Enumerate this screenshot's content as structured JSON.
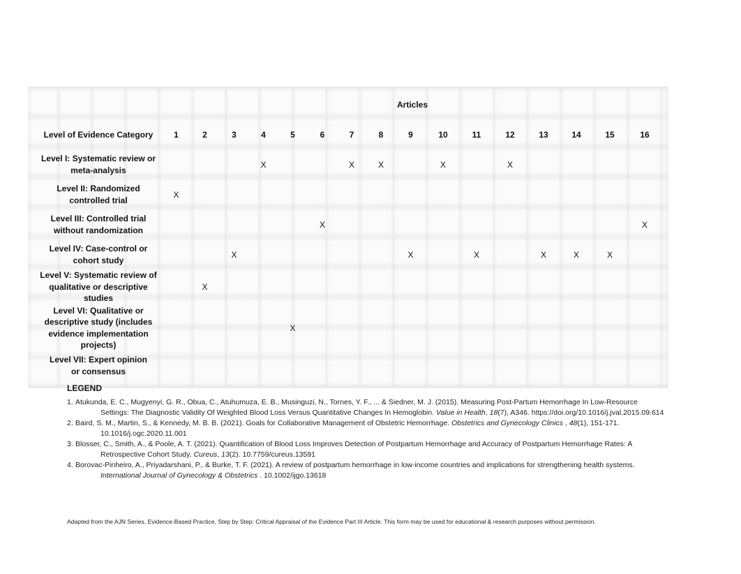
{
  "table": {
    "articles_header": "Articles",
    "category_header": "Level of Evidence Category",
    "mark": "X",
    "article_numbers": [
      "1",
      "2",
      "3",
      "4",
      "5",
      "6",
      "7",
      "8",
      "9",
      "10",
      "11",
      "12",
      "13",
      "14",
      "15",
      "16"
    ],
    "rows": [
      {
        "label_lines": [
          "Level  I: Systematic review or",
          "meta-analysis"
        ],
        "marked": [
          4,
          7,
          8,
          10,
          12
        ]
      },
      {
        "label_lines": [
          "Level  II: Randomized",
          "controlled trial"
        ],
        "marked": [
          1
        ]
      },
      {
        "label_lines": [
          "Level  III: Controlled trial",
          "without randomization"
        ],
        "marked": [
          6,
          16
        ]
      },
      {
        "label_lines": [
          "Level  IV: Case-control or",
          "cohort study"
        ],
        "marked": [
          3,
          9,
          11,
          13,
          14,
          15
        ]
      },
      {
        "label_lines": [
          "Level V: Systematic review of",
          "qualitative or descriptive",
          "studies"
        ],
        "marked": [
          2
        ]
      },
      {
        "label_lines": [
          "Level  VI: Qualitative or",
          "descriptive study (includes",
          "evidence implementation",
          "projects)"
        ],
        "marked": [
          5
        ]
      },
      {
        "label_lines": [
          "Level  VII: Expert opinion",
          "or consensus"
        ],
        "marked": []
      }
    ]
  },
  "legend": {
    "title": "LEGEND",
    "references": [
      {
        "num": "1.",
        "pre": "Atukunda, E. C., Mugyenyi, G. R., Obua, C., Atuhumuza, E. B., Musinguzi, N., Tornes, Y. F., ... & Siedner, M. J. (2015). Measuring Post-Partum Hemorrhage In Low-Resource Settings: The Diagnostic Validity Of Weighted Blood Loss Versus Quantitative Changes In Hemoglobin. ",
        "journal": "Value in Health",
        "sep": ", ",
        "volume": "18",
        "post": "(7), A346. https://doi.org/10.1016/j.jval.2015.09.614"
      },
      {
        "num": "2.",
        "pre": "Baird, S. M., Martin, S., & Kennedy, M. B. B. (2021). Goals for Collaborative Management of Obstetric Hemorrhage.  ",
        "journal": "Obstetrics and Gynecology Clinics",
        "sep": " , ",
        "volume": "48",
        "post": "(1), 151-171. 10.1016/j.ogc.2020.11.001"
      },
      {
        "num": "3.",
        "pre": "Blosser, C., Smith, A., & Poole, A. T. (2021). Quantification of Blood Loss Improves Detection of Postpartum Hemorrhage and Accuracy of Postpartum Hemorrhage Rates: A Retrospective Cohort Study. ",
        "journal": "Cureus",
        "sep": ", ",
        "volume": "13",
        "post": "(2).  10.7759/cureus.13591"
      },
      {
        "num": "4.",
        "pre": "Borovac-Pinheiro, A., Priyadarshani, P., & Burke, T. F. (2021). A review of postpartum hemorrhage in low-income countries and implications for strengthening health systems. ",
        "journal": "International Journal of Gynecology & Obstetrics",
        "sep": " . ",
        "volume": "",
        "post": "10.1002/ijgo.13618"
      }
    ]
  },
  "footer": "Adapted from the AJN Series, Evidence-Based Practice, Step by Step: Critical Appraisal of the Evidence Part III Article. This form may be used for educational & research purposes without permission."
}
